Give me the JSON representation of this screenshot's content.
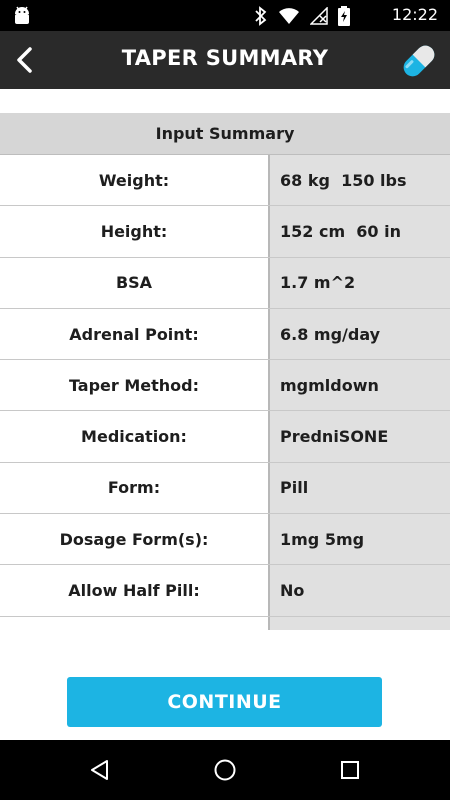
{
  "status_bar": {
    "time": "12:22",
    "icons": [
      "android-icon",
      "bluetooth-icon",
      "wifi-icon",
      "no-signal-icon",
      "battery-charging-icon"
    ]
  },
  "app_bar": {
    "title": "TAPER SUMMARY",
    "back_icon": "back-arrow-icon",
    "logo_icon": "pill-capsule-icon",
    "accent_color": "#1db4e3"
  },
  "summary": {
    "header": "Input Summary",
    "rows": [
      {
        "label": "Weight:",
        "value": "68 kg  150 lbs"
      },
      {
        "label": "Height:",
        "value": "152 cm  60 in"
      },
      {
        "label": "BSA",
        "value": "1.7 m^2"
      },
      {
        "label": "Adrenal Point:",
        "value": "6.8 mg/day"
      },
      {
        "label": "Taper Method:",
        "value": "mgmldown"
      },
      {
        "label": "Medication:",
        "value": "PredniSONE"
      },
      {
        "label": "Form:",
        "value": "Pill"
      },
      {
        "label": "Dosage Form(s):",
        "value": "1mg 5mg"
      },
      {
        "label": "Allow Half Pill:",
        "value": "No"
      }
    ]
  },
  "actions": {
    "continue_label": "CONTINUE",
    "button_color": "#1db4e3"
  },
  "nav_bar": {
    "icons": [
      "back-triangle-icon",
      "home-circle-icon",
      "recents-square-icon"
    ]
  }
}
